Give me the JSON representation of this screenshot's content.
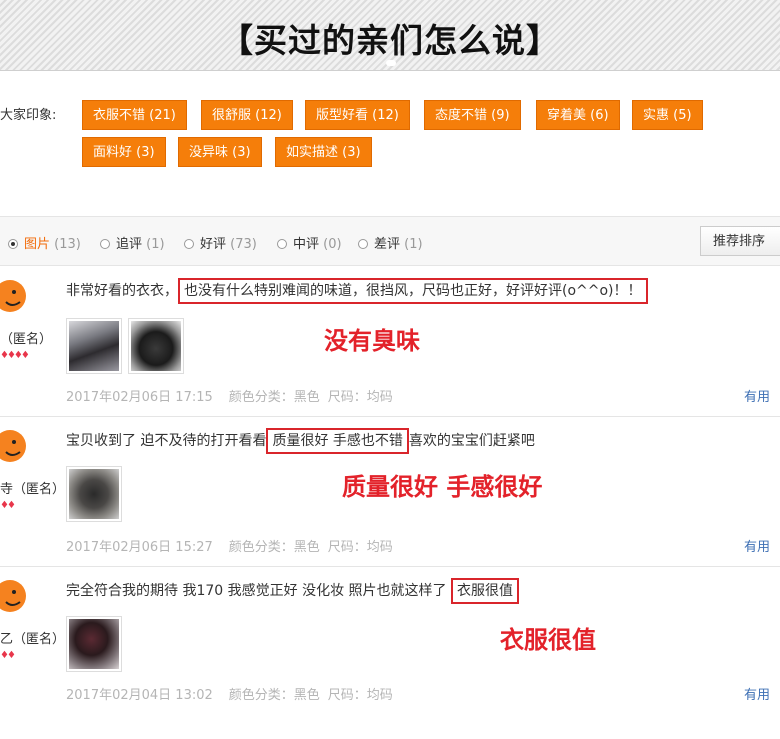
{
  "banner": {
    "title": "【买过的亲们怎么说】"
  },
  "impressions": {
    "label": "大家印象:",
    "tags": [
      "衣服不错 (21)",
      "很舒服 (12)",
      "版型好看 (12)",
      "态度不错 (9)",
      "穿着美 (6)",
      "实惠 (5)",
      "面料好 (3)",
      "没异味 (3)",
      "如实描述 (3)"
    ]
  },
  "filters": {
    "options": [
      {
        "label": "图片",
        "count": "(13)",
        "selected": true
      },
      {
        "label": "追评",
        "count": "(1)",
        "selected": false
      },
      {
        "label": "好评",
        "count": "(73)",
        "selected": false
      },
      {
        "label": "中评",
        "count": "(0)",
        "selected": false
      },
      {
        "label": "差评",
        "count": "(1)",
        "selected": false
      }
    ],
    "sort_label": "推荐排序"
  },
  "reviews": [
    {
      "user": "（匿名）",
      "text_before": "非常好看的衣衣，",
      "text_highlight": "也没有什么特别难闻的味道，很挡风，尺码也正好，好评好评(o^^o)！！",
      "text_after": "",
      "callout": "没有臭味",
      "date": "2017年02月06日 17:15",
      "color_label": "颜色分类：黑色",
      "size_label": "尺码：均码",
      "useful": "有用"
    },
    {
      "user": "寺（匿名）",
      "text_before": "宝贝收到了 迫不及待的打开看看",
      "text_highlight": "质量很好 手感也不错",
      "text_after": "喜欢的宝宝们赶紧吧",
      "callout": "质量很好 手感很好",
      "date": "2017年02月06日 15:27",
      "color_label": "颜色分类：黑色",
      "size_label": "尺码：均码",
      "useful": "有用"
    },
    {
      "user": "乙（匿名）",
      "text_before": "完全符合我的期待 我170 我感觉正好 没化妆 照片也就这样了",
      "text_highlight": "衣服很值",
      "text_after": "",
      "callout": "衣服很值",
      "date": "2017年02月04日 13:02",
      "color_label": "颜色分类：黑色",
      "size_label": "尺码：均码",
      "useful": "有用"
    }
  ]
}
